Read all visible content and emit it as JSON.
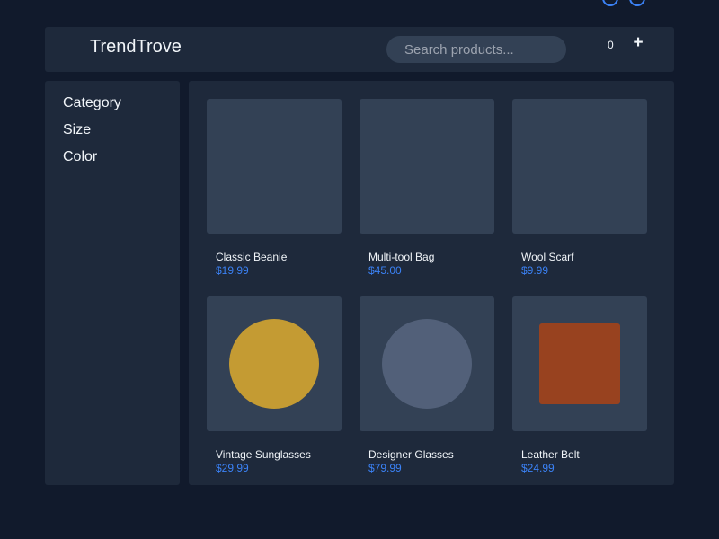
{
  "header": {
    "brand": "TrendTrove",
    "search_placeholder": "Search products...",
    "cart_count": "0",
    "add_label": "+"
  },
  "sidebar": {
    "items": [
      {
        "label": "Category"
      },
      {
        "label": "Size"
      },
      {
        "label": "Color"
      }
    ]
  },
  "products": [
    {
      "name": "Classic Beanie",
      "price": "$19.99",
      "icon": "none"
    },
    {
      "name": "Multi-tool Bag",
      "price": "$45.00",
      "icon": "none"
    },
    {
      "name": "Wool Scarf",
      "price": "$9.99",
      "icon": "none"
    },
    {
      "name": "Vintage Sunglasses",
      "price": "$29.99",
      "icon": "circle",
      "color": "#c49b33"
    },
    {
      "name": "Designer Glasses",
      "price": "$79.99",
      "icon": "circle",
      "color": "#526079"
    },
    {
      "name": "Leather Belt",
      "price": "$24.99",
      "icon": "square",
      "color": "#98421f"
    }
  ],
  "colors": {
    "background": "#111a2c",
    "panel": "#1e293b",
    "card": "#334155",
    "accent": "#3b82f6",
    "text": "#f1f5f9"
  }
}
